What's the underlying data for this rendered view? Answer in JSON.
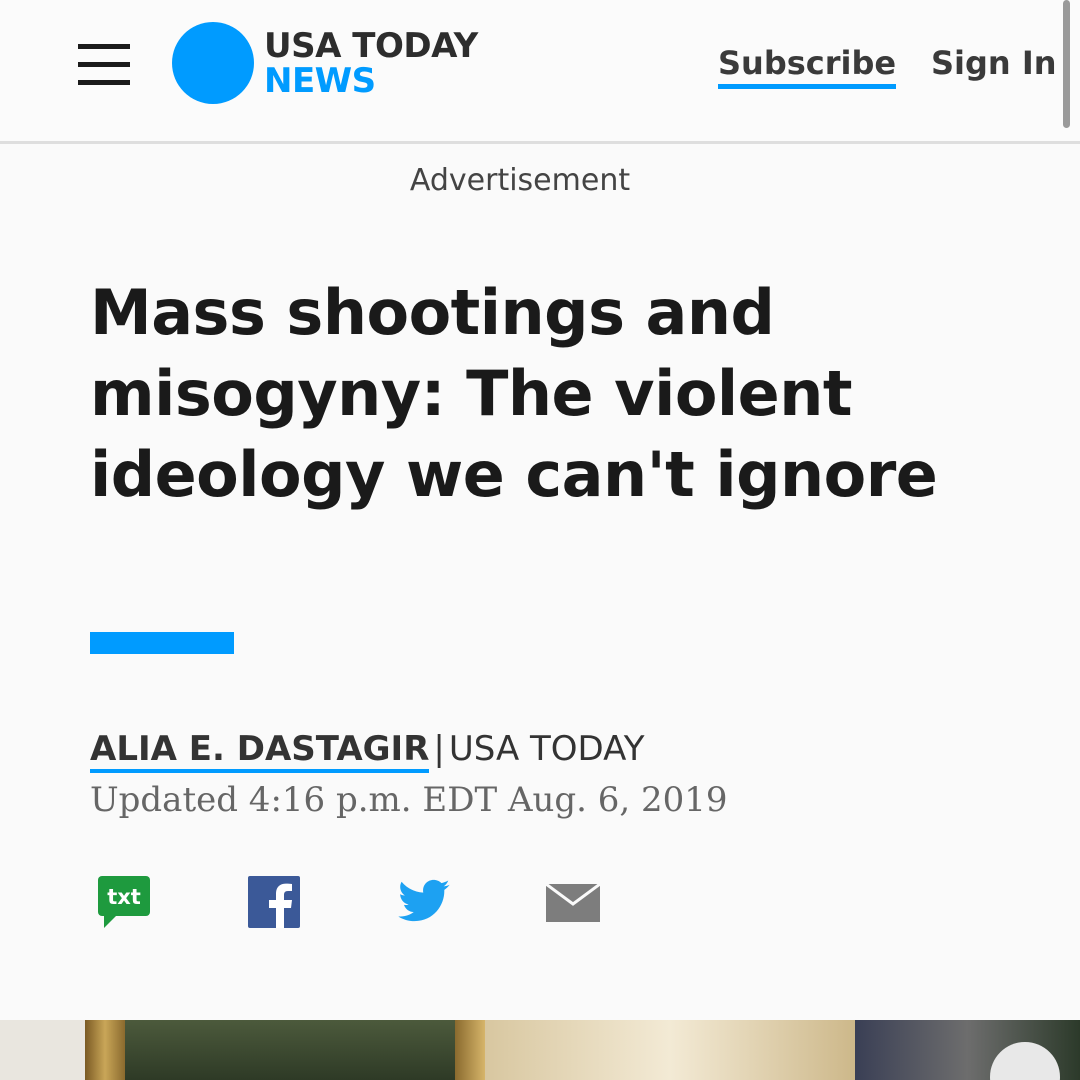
{
  "header": {
    "brand_line1": "USA TODAY",
    "brand_line2": "NEWS",
    "subscribe_label": "Subscribe",
    "signin_label": "Sign In"
  },
  "advertisement_label": "Advertisement",
  "article": {
    "headline": "Mass shootings and misogyny: The violent ideology we can't ignore",
    "author": "ALIA E. DASTAGIR",
    "separator": "|",
    "source": "USA TODAY",
    "updated": "Updated 4:16 p.m. EDT Aug. 6, 2019"
  },
  "share": {
    "txt_label": "txt",
    "icons": [
      "sms-txt-icon",
      "facebook-icon",
      "twitter-icon",
      "email-icon"
    ]
  },
  "colors": {
    "accent": "#009bff",
    "text": "#1a1a1a",
    "sms_green": "#1e9a3e",
    "facebook_blue": "#3b5998",
    "twitter_blue": "#1da1f2",
    "mail_gray": "#7d7d7d"
  }
}
